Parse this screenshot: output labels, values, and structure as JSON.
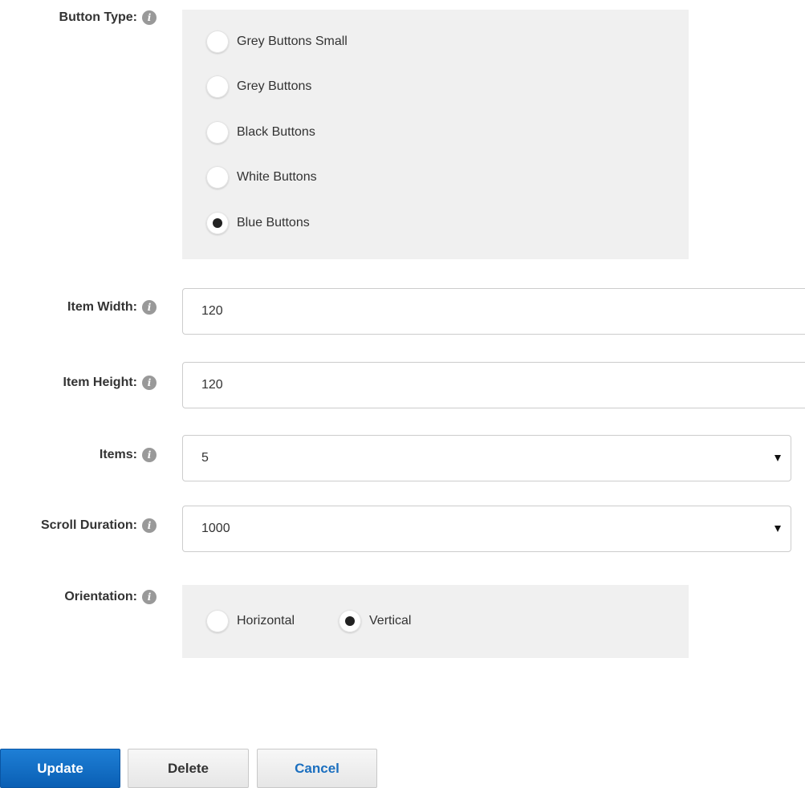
{
  "fields": {
    "button_type": {
      "label": "Button Type:",
      "options": [
        {
          "label": "Grey Buttons Small",
          "selected": false
        },
        {
          "label": "Grey Buttons",
          "selected": false
        },
        {
          "label": "Black Buttons",
          "selected": false
        },
        {
          "label": "White Buttons",
          "selected": false
        },
        {
          "label": "Blue Buttons",
          "selected": true
        }
      ]
    },
    "item_width": {
      "label": "Item Width:",
      "value": "120"
    },
    "item_height": {
      "label": "Item Height:",
      "value": "120"
    },
    "items": {
      "label": "Items:",
      "value": "5"
    },
    "scroll_duration": {
      "label": "Scroll Duration:",
      "value": "1000"
    },
    "orientation": {
      "label": "Orientation:",
      "options": [
        {
          "label": "Horizontal",
          "selected": false
        },
        {
          "label": "Vertical",
          "selected": true
        }
      ]
    }
  },
  "buttons": {
    "update": "Update",
    "delete": "Delete",
    "cancel": "Cancel"
  },
  "info_glyph": "i",
  "colors": {
    "primary_button": "#1470c8",
    "panel_background": "#f0f0f0",
    "cancel_text": "#1b6fbf"
  }
}
